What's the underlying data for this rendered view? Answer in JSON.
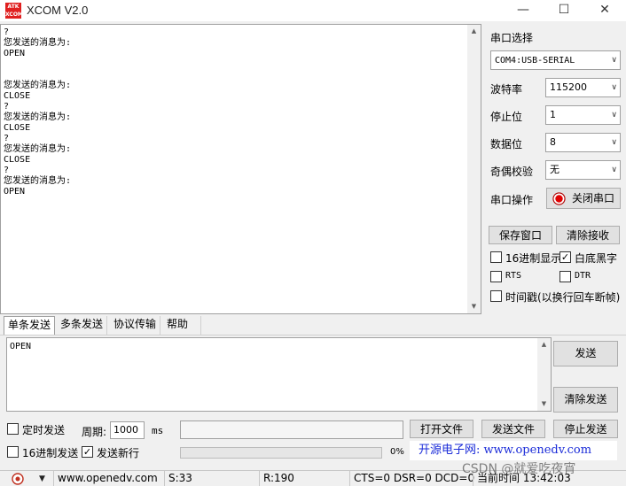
{
  "window": {
    "title": "XCOM V2.0",
    "icon_text": "ATK XCOM",
    "minimize_glyph": "—",
    "maximize_glyph": "☐",
    "close_glyph": "✕"
  },
  "receive": {
    "text": "?\n您发送的消息为:\nOPEN\n\n\n您发送的消息为:\nCLOSE\n?\n您发送的消息为:\nCLOSE\n?\n您发送的消息为:\nCLOSE\n?\n您发送的消息为:\nOPEN"
  },
  "serial": {
    "port_select_label": "串口选择",
    "port_value": "COM4:USB-SERIAL",
    "baud_label": "波特率",
    "baud_value": "115200",
    "stopbit_label": "停止位",
    "stopbit_value": "1",
    "databit_label": "数据位",
    "databit_value": "8",
    "parity_label": "奇偶校验",
    "parity_value": "无",
    "op_label": "串口操作",
    "close_port_label": "关闭串口",
    "led_color": "#e00000"
  },
  "buttons": {
    "save_window": "保存窗口",
    "clear_receive": "清除接收",
    "send": "发送",
    "clear_send": "清除发送",
    "open_file": "打开文件",
    "send_file": "发送文件",
    "stop_send": "停止发送"
  },
  "options": {
    "hex_display": "16进制显示",
    "hex_display_checked": false,
    "white_bg": "白底黑字",
    "white_bg_checked": true,
    "rts": "RTS",
    "rts_checked": false,
    "dtr": "DTR",
    "dtr_checked": false,
    "timestamp": "时间戳(以换行回车断帧)",
    "timestamp_checked": false
  },
  "tabs": [
    {
      "label": "单条发送",
      "active": true
    },
    {
      "label": "多条发送",
      "active": false
    },
    {
      "label": "协议传输",
      "active": false
    },
    {
      "label": "帮助",
      "active": false
    }
  ],
  "send": {
    "text": "OPEN",
    "timed_send": "定时发送",
    "timed_send_checked": false,
    "period_label": "周期:",
    "period_value": "1000",
    "period_unit": "ms",
    "hex_send": "16进制发送",
    "hex_send_checked": false,
    "newline": "发送新行",
    "newline_checked": true,
    "progress_text": "0%",
    "progress": 0
  },
  "promo": "开源电子网: www.openedv.com",
  "status": {
    "website": "www.openedv.com",
    "sent": "S:33",
    "received": "R:190",
    "lines": "CTS=0 DSR=0 DCD=0",
    "time": "当前时间 13:42:03"
  },
  "watermark": "CSDN @就爱吃夜宵",
  "check_glyph": "✓"
}
